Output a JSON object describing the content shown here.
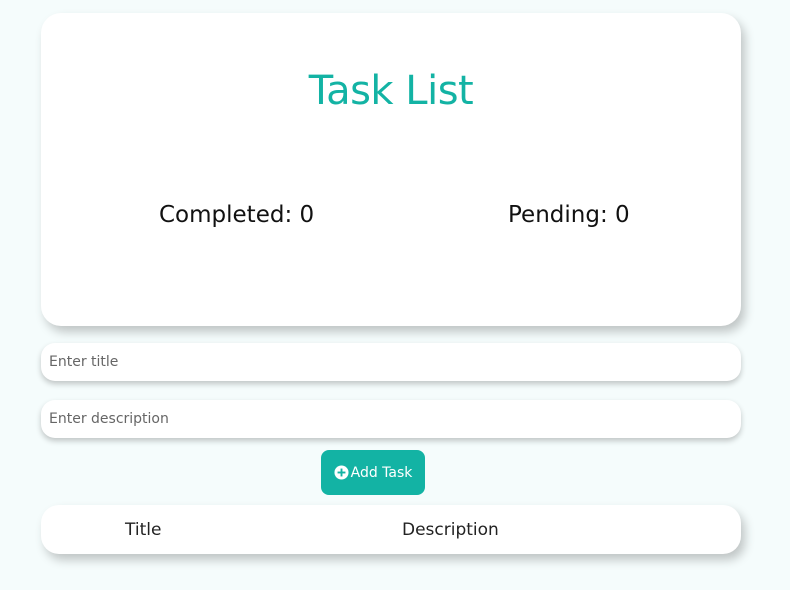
{
  "header": {
    "title": "Task List"
  },
  "stats": {
    "completed_label": "Completed: 0",
    "pending_label": "Pending: 0",
    "completed_count": 0,
    "pending_count": 0
  },
  "form": {
    "title_placeholder": "Enter title",
    "title_value": "",
    "description_placeholder": "Enter description",
    "description_value": "",
    "add_button_label": "Add Task",
    "add_button_icon": "plus-circle-icon"
  },
  "table": {
    "columns": [
      "Title",
      "Description"
    ],
    "rows": []
  },
  "colors": {
    "accent": "#13b3a4",
    "background": "#f5fcfc",
    "card": "#ffffff"
  }
}
